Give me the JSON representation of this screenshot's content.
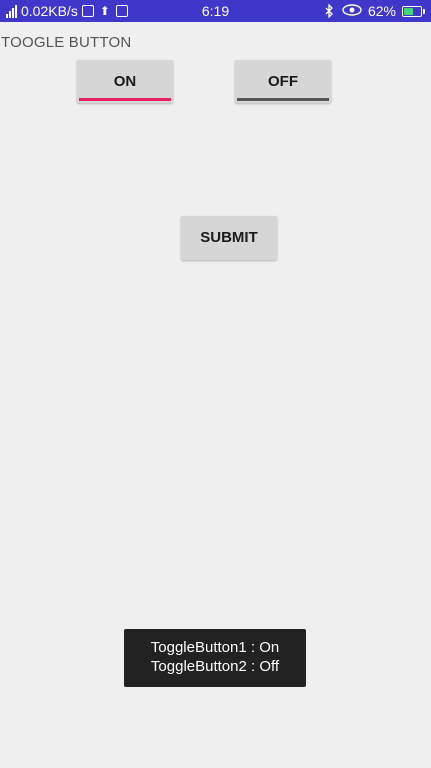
{
  "status_bar": {
    "network_speed": "0.02KB/s",
    "time": "6:19",
    "battery_percent": "62%",
    "battery_level": 0.62,
    "icons": [
      "signal-icon",
      "vpn-badge-icon",
      "upload-icon",
      "notification-badge-icon",
      "bluetooth-icon",
      "eye-icon",
      "battery-icon"
    ]
  },
  "app": {
    "title": "TOOGLE BUTTON"
  },
  "toggles": {
    "first": {
      "label": "ON",
      "state": "on",
      "indicator_color": "#e91e63"
    },
    "second": {
      "label": "OFF",
      "state": "off",
      "indicator_color": "#555555"
    }
  },
  "submit": {
    "label": "SUBMIT"
  },
  "toast": {
    "line1": "ToggleButton1 : On",
    "line2": "ToggleButton2 : Off"
  },
  "colors": {
    "status_bar_bg": "#3f37c9",
    "page_bg": "#efefef",
    "button_bg": "#d6d6d6",
    "toggle_on_accent": "#e91e63",
    "toast_bg": "#222222"
  }
}
